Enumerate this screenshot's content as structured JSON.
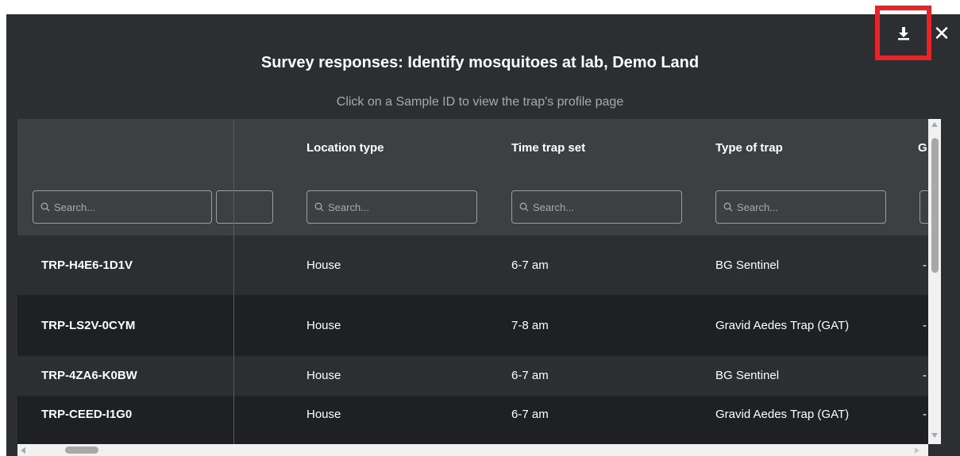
{
  "modal": {
    "title": "Survey responses: Identify mosquitoes at lab, Demo Land",
    "subtitle": "Click on a Sample ID to view the trap's profile page",
    "download_icon": "download-icon",
    "close_icon": "close-icon",
    "close_glyph": "✕"
  },
  "table": {
    "columns": [
      "",
      "Location type",
      "Time trap set",
      "Type of trap",
      "G"
    ],
    "search_placeholder": "Search...",
    "rows": [
      {
        "id": "TRP-H4E6-1D1V",
        "location": "House",
        "time": "6-7 am",
        "trap": "BG Sentinel",
        "extra": "-"
      },
      {
        "id": "TRP-LS2V-0CYM",
        "location": "House",
        "time": "7-8 am",
        "trap": "Gravid Aedes Trap (GAT)",
        "extra": "-"
      },
      {
        "id": "TRP-4ZA6-K0BW",
        "location": "House",
        "time": "6-7 am",
        "trap": "BG Sentinel",
        "extra": "-"
      },
      {
        "id": "TRP-CEED-I1G0",
        "location": "House",
        "time": "6-7 am",
        "trap": "Gravid Aedes Trap (GAT)",
        "extra": "-"
      }
    ]
  },
  "colors": {
    "modal_bg": "#2d2e31",
    "header_bg": "#3e3f43",
    "row_dark": "#1f2023",
    "highlight": "#e3262a"
  }
}
